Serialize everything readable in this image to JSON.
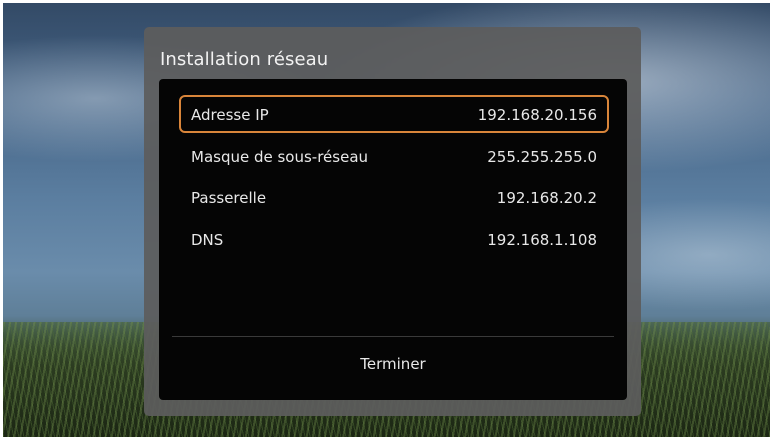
{
  "dialog": {
    "title": "Installation réseau",
    "rows": [
      {
        "label": "Adresse IP",
        "value": "192.168.20.156",
        "selected": true
      },
      {
        "label": "Masque de sous-réseau",
        "value": "255.255.255.0",
        "selected": false
      },
      {
        "label": "Passerelle",
        "value": "192.168.20.2",
        "selected": false
      },
      {
        "label": "DNS",
        "value": "192.168.1.108",
        "selected": false
      }
    ],
    "finish_label": "Terminer"
  },
  "colors": {
    "selection_border": "#d9853a",
    "dialog_background": "#5c5c5c",
    "panel_background": "#050505",
    "text": "#e8e8e8"
  }
}
